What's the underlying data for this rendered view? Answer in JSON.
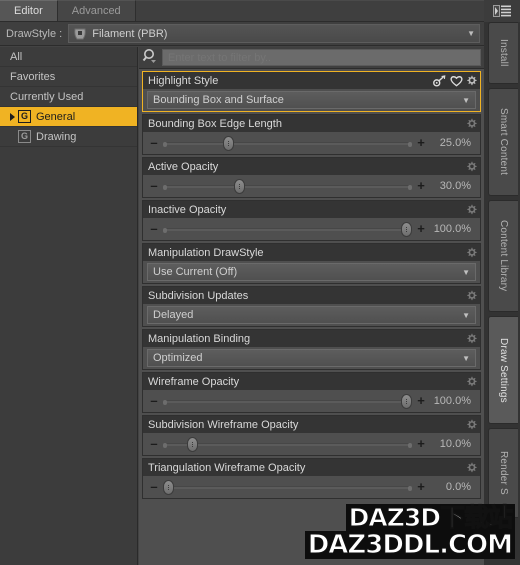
{
  "window": {
    "tabs": [
      {
        "label": "Editor",
        "active": true
      },
      {
        "label": "Advanced",
        "active": false
      }
    ],
    "menu_icon": "hamburger-menu-icon"
  },
  "drawstyle": {
    "label": "DrawStyle :",
    "value": "Filament (PBR)",
    "icon": "drawstyle-preset-icon",
    "arrow": "▼"
  },
  "sidebar": {
    "items": [
      {
        "label": "All",
        "icon": null,
        "expander": false,
        "selected": false
      },
      {
        "label": "Favorites",
        "icon": null,
        "expander": false,
        "selected": false
      },
      {
        "label": "Currently Used",
        "icon": null,
        "expander": false,
        "selected": false
      },
      {
        "label": "General",
        "icon": "G",
        "expander": true,
        "selected": true
      },
      {
        "label": "Drawing",
        "icon": "G",
        "expander": false,
        "selected": false
      }
    ]
  },
  "filter": {
    "placeholder": "Enter text to filter by..",
    "value": "",
    "icon": "search-icon"
  },
  "properties": [
    {
      "name": "Highlight Style",
      "type": "combo",
      "value": "Bounding Box and Surface",
      "focused": true,
      "head_icons": [
        "link-icon",
        "heart-icon",
        "gear-icon"
      ]
    },
    {
      "name": "Bounding Box Edge Length",
      "type": "slider",
      "value": "25.0%",
      "percent": 25,
      "focused": false,
      "head_icons": [
        "gear-icon"
      ]
    },
    {
      "name": "Active Opacity",
      "type": "slider",
      "value": "30.0%",
      "percent": 30,
      "focused": false,
      "head_icons": [
        "gear-icon"
      ]
    },
    {
      "name": "Inactive Opacity",
      "type": "slider",
      "value": "100.0%",
      "percent": 100,
      "focused": false,
      "head_icons": [
        "gear-icon"
      ]
    },
    {
      "name": "Manipulation DrawStyle",
      "type": "combo",
      "value": "Use Current (Off)",
      "focused": false,
      "head_icons": [
        "gear-icon"
      ]
    },
    {
      "name": "Subdivision Updates",
      "type": "combo",
      "value": "Delayed",
      "focused": false,
      "head_icons": [
        "gear-icon"
      ]
    },
    {
      "name": "Manipulation Binding",
      "type": "combo",
      "value": "Optimized",
      "focused": false,
      "head_icons": [
        "gear-icon"
      ]
    },
    {
      "name": "Wireframe Opacity",
      "type": "slider",
      "value": "100.0%",
      "percent": 100,
      "focused": false,
      "head_icons": [
        "gear-icon"
      ]
    },
    {
      "name": "Subdivision Wireframe Opacity",
      "type": "slider",
      "value": "10.0%",
      "percent": 10,
      "focused": false,
      "head_icons": [
        "gear-icon"
      ]
    },
    {
      "name": "Triangulation Wireframe Opacity",
      "type": "slider",
      "value": "0.0%",
      "percent": 0,
      "focused": false,
      "head_icons": [
        "gear-icon"
      ]
    }
  ],
  "slider_controls": {
    "minus": "–",
    "plus": "＋"
  },
  "vertical_tabs": [
    {
      "label": "Install",
      "active": false
    },
    {
      "label": "Smart Content",
      "active": false
    },
    {
      "label": "Content Library",
      "active": false
    },
    {
      "label": "Draw Settings",
      "active": true
    },
    {
      "label": "Render S",
      "active": false
    }
  ],
  "watermark": {
    "line1": "DAZ3D下载站",
    "line2": "DAZ3DDL.COM"
  },
  "colors": {
    "accent": "#f0b323",
    "panel": "#4f4f4f",
    "header": "#343434",
    "chrome": "#3c3c3c"
  }
}
